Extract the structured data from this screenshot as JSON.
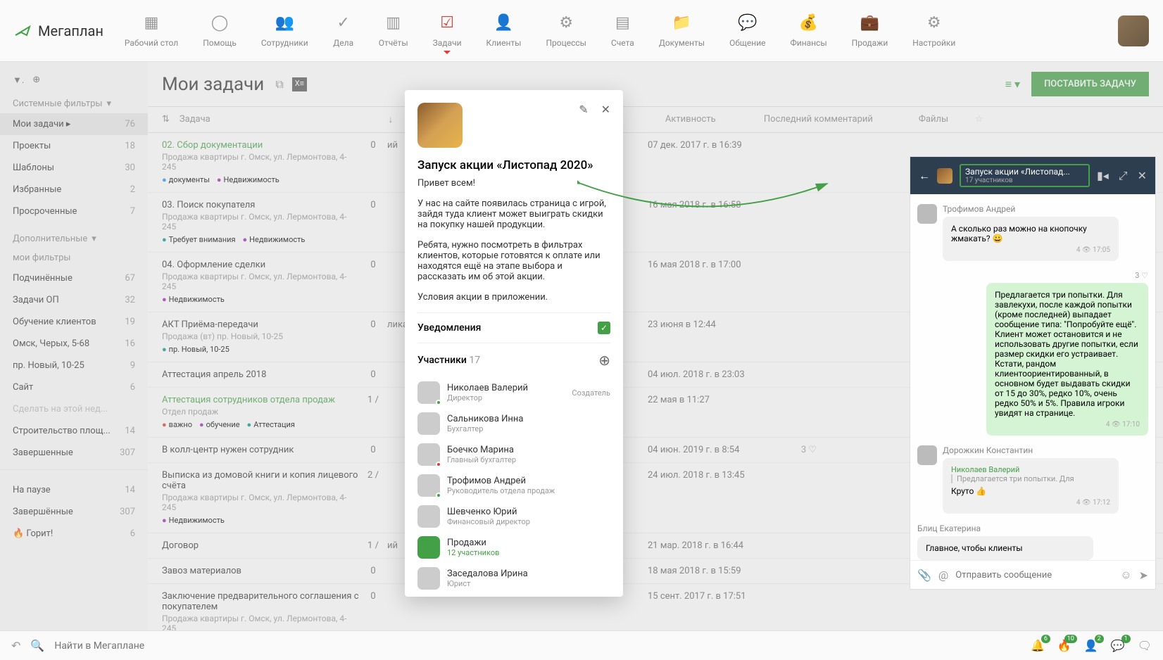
{
  "logo": "Мегаплан",
  "nav": [
    {
      "label": "Рабочий стол"
    },
    {
      "label": "Помощь"
    },
    {
      "label": "Сотрудники"
    },
    {
      "label": "Дела"
    },
    {
      "label": "Отчёты"
    },
    {
      "label": "Задачи",
      "active": true
    },
    {
      "label": "Клиенты"
    },
    {
      "label": "Процессы"
    },
    {
      "label": "Счета"
    },
    {
      "label": "Документы"
    },
    {
      "label": "Общение"
    },
    {
      "label": "Финансы"
    },
    {
      "label": "Продажи"
    },
    {
      "label": "Настройки"
    }
  ],
  "sidebar": {
    "system_label": "Системные фильтры",
    "items1": [
      {
        "label": "Мои задачи",
        "count": "76",
        "active": true
      },
      {
        "label": "Проекты",
        "count": "18"
      },
      {
        "label": "Шаблоны",
        "count": "30"
      },
      {
        "label": "Избранные",
        "count": "2"
      },
      {
        "label": "Просроченные",
        "count": "7"
      }
    ],
    "extra_label": "Дополнительные",
    "my_label": "мои фильтры",
    "items2": [
      {
        "label": "Подчинённые",
        "count": "67"
      },
      {
        "label": "Задачи ОП",
        "count": "32"
      },
      {
        "label": "Обучение клиентов",
        "count": "19"
      },
      {
        "label": "Омск, Черых, 5-68",
        "count": "16"
      },
      {
        "label": "пр. Новый, 10-25",
        "count": "9"
      },
      {
        "label": "Сайт",
        "count": "6"
      },
      {
        "label": "Сделать на этой нед...",
        "count": "",
        "disabled": true
      },
      {
        "label": "Строительство площ...",
        "count": "14"
      },
      {
        "label": "Завершенные",
        "count": "307"
      }
    ],
    "items3": [
      {
        "label": "На паузе",
        "count": "14"
      },
      {
        "label": "Завершённые",
        "count": "307"
      },
      {
        "label": "🔥 Горит!",
        "count": "6"
      }
    ]
  },
  "page": {
    "title": "Мои задачи",
    "button": "ПОСТАВИТЬ ЗАДАЧУ"
  },
  "cols": {
    "task": "Задача",
    "activity": "Активность",
    "comment": "Последний комментарий",
    "files": "Файлы"
  },
  "tasks": [
    {
      "title": "02. Сбор документации",
      "green": true,
      "sub": "Продажа квартиры г. Омск, ул. Лермонтова, 4-245",
      "tags": [
        {
          "t": "документы",
          "c": "blue"
        },
        {
          "t": "Недвижимость",
          "c": "purple"
        }
      ],
      "cnt": "0",
      "person": "ий",
      "act": "07 дек. 2017 г. в 16:39"
    },
    {
      "title": "03. Поиск покупателя",
      "sub": "Продажа квартиры г. Омск, ул. Лермонтова, 4-245",
      "tags": [
        {
          "t": "Требует внимания",
          "c": "teal"
        },
        {
          "t": "Недвижимость",
          "c": "purple"
        }
      ],
      "cnt": "0",
      "act": "16 мая 2018 г. в 16:58"
    },
    {
      "title": "04. Оформление сделки",
      "sub": "Продажа квартиры г. Омск, ул. Лермонтова, 4-245",
      "tags": [
        {
          "t": "Недвижимость",
          "c": "purple"
        }
      ],
      "cnt": "0",
      "act": "16 мая 2018 г. в 17:00"
    },
    {
      "title": "АКТ Приёма-передачи",
      "sub": "Продажа (вт) пр. Новый, 10-25",
      "tags": [
        {
          "t": "пр. Новый, 10-25",
          "c": "teal"
        }
      ],
      "cnt": "0",
      "person": "лика",
      "act": "23 июня в 12:44"
    },
    {
      "title": "Аттестация апрель 2018",
      "cnt": "0",
      "act": "04 июл. 2018 г. в 23:03"
    },
    {
      "title": "Аттестация сотрудников отдела продаж",
      "green": true,
      "sub": "Отдел продаж",
      "tags": [
        {
          "t": "важно",
          "c": "red"
        },
        {
          "t": "обучение",
          "c": "purple"
        },
        {
          "t": "Аттестация",
          "c": "teal"
        }
      ],
      "cnt": "1 /",
      "act": "22 мая в 11:27"
    },
    {
      "title": "В колл-центр нужен сотрудник",
      "cnt": "0",
      "act": "04 июн. 2019 г. в 8:54",
      "com": "3 ♡"
    },
    {
      "title": "Выписка из домовой книги и копия лицевого счёта",
      "sub": "Продажа квартиры г. Омск, ул. Лермонтова, 4-245",
      "tags": [
        {
          "t": "Недвижимость",
          "c": "purple"
        }
      ],
      "cnt": "2 /",
      "act": "24 июл. 2018 г. в 13:45"
    },
    {
      "title": "Договор",
      "cnt": "1 /",
      "person": "ий",
      "act": "21 мар. 2018 г. в 16:44"
    },
    {
      "title": "Завоз материалов",
      "cnt": "0",
      "act": "18 мая 2018 г. в 15:59"
    },
    {
      "title": "Заключение предварительного соглашения с покупателем",
      "sub": "Продажа квартиры г. Омск, ул. Лермонтова, 4-245",
      "tags": [
        {
          "t": "Недвижимость",
          "c": "purple"
        }
      ],
      "cnt": "0",
      "act": "15 сент. 2017 г. в 17:51"
    }
  ],
  "modal": {
    "title": "Запуск акции «Листопад 2020»",
    "greet": "Привет всем!",
    "p1": "У нас на сайте появилась страница с игрой, зайдя туда клиент может выиграть скидки на покупку нашей продукции.",
    "p2": "Ребята, нужно посмотреть в фильтрах клиентов, которые готовятся к оплате или находятся ещё на этапе выбора и рассказать им об этой акции.",
    "p3": "Условия акции в приложении.",
    "notif": "Уведомления",
    "part_label": "Участники",
    "part_count": "17",
    "creator": "Создатель",
    "participants": [
      {
        "name": "Николаев Валерий",
        "role": "Директор",
        "creator": true,
        "dot": "green"
      },
      {
        "name": "Сальникова Инна",
        "role": "Бухгалтер"
      },
      {
        "name": "Боечко Марина",
        "role": "Главный бухгалтер",
        "dot": "red"
      },
      {
        "name": "Трофимов Андрей",
        "role": "Руководитель отдела продаж",
        "dot": "green"
      },
      {
        "name": "Шевченко Юрий",
        "role": "Финансовый директор"
      },
      {
        "name": "Продажи",
        "role": "12 участников",
        "avatar_green": true
      },
      {
        "name": "Заседалова Ирина",
        "role": "Юрист"
      }
    ]
  },
  "chat": {
    "title": "Запуск акции «Листопад...",
    "sub": "17 участников",
    "msgs": [
      {
        "author": "Трофимов Андрей",
        "text": "А сколько раз можно на кнопочку жмакать? 😀",
        "meta": "4 👁 17:05",
        "type": "grey",
        "avatar": true
      },
      {
        "text": "Предлагается три попытки. Для завлекухи, после каждой попытки (кроме последней) выпадает сообщение типа: \"Попробуйте ещё\". Клиент может остановится и не использовать другие попытки, если размер скидки его устраивает. Кстати, рандом клиентоориентированный, в основном будет выдавать скидки от 15 до 30%, редко 10%, очень редко 50% и 5%. Правила игроки увидят на странице.",
        "meta": "4 👁 17:10",
        "type": "green",
        "likes": "3 ♡"
      },
      {
        "author": "Дорожкин Константин",
        "author2": "Николаев Валерий",
        "quote": "Предлагается три попытки. Для",
        "text": "Круто 👍",
        "meta": "4 👁 17:12",
        "type": "grey",
        "avatar": true
      },
      {
        "author": "Блиц Екатерина",
        "text": "Главное, чтобы клиенты",
        "type": "grey"
      }
    ],
    "placeholder": "Отправить сообщение"
  },
  "footer": {
    "search": "Найти в Мегаплане",
    "badges": [
      "6",
      "10",
      "2",
      "1"
    ]
  }
}
